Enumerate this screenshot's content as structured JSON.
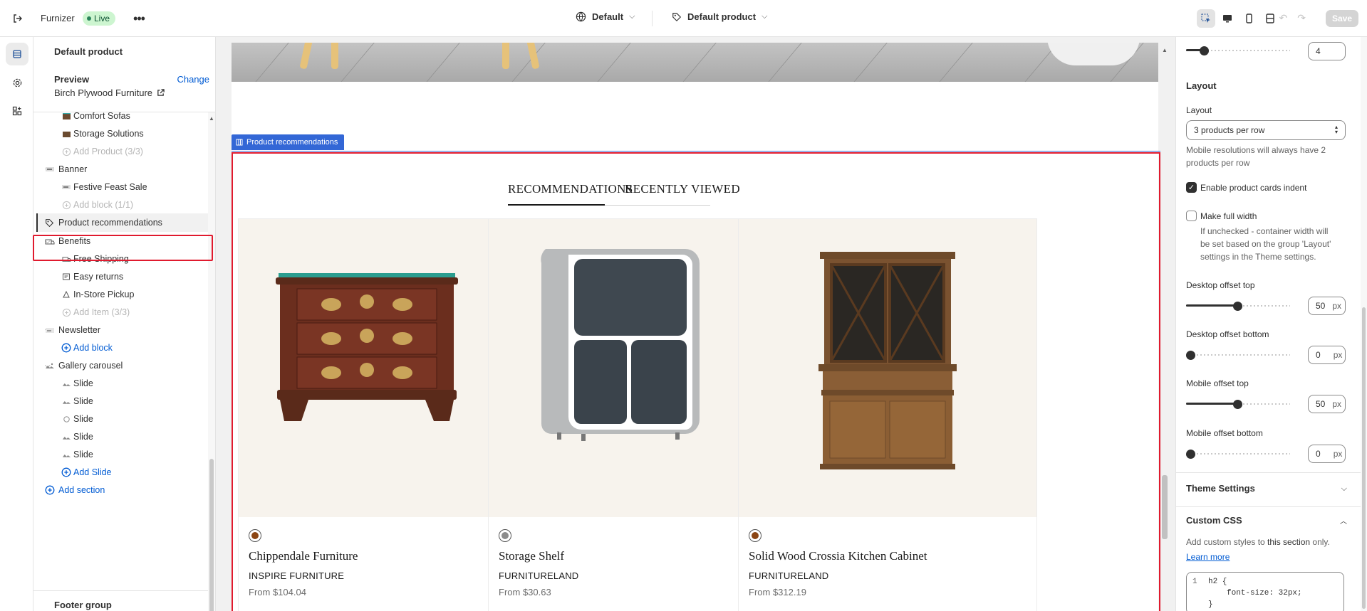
{
  "topbar": {
    "app_name": "Furnizer",
    "status_badge": "Live",
    "more_label": "•••",
    "theme_select": "Default",
    "template_select": "Default product",
    "save_label": "Save"
  },
  "sidebar": {
    "title": "Default product",
    "preview_label": "Preview",
    "change_label": "Change",
    "preview_store": "Birch Plywood Furniture",
    "items": [
      {
        "label": "Comfort Sofas",
        "level": 2,
        "icon": "product-icon"
      },
      {
        "label": "Storage Solutions",
        "level": 2,
        "icon": "product-icon"
      },
      {
        "label": "Add Product (3/3)",
        "level": 2,
        "icon": "plus-circle-icon",
        "state": "disabled"
      },
      {
        "label": "Banner",
        "level": 1,
        "icon": "banner-icon",
        "expanded": true
      },
      {
        "label": "Festive Feast Sale",
        "level": 2,
        "icon": "banner-icon"
      },
      {
        "label": "Add block (1/1)",
        "level": 2,
        "icon": "plus-circle-icon",
        "state": "disabled"
      },
      {
        "label": "Product recommendations",
        "level": 1,
        "icon": "tag-icon",
        "state": "selected"
      },
      {
        "label": "Benefits",
        "level": 1,
        "icon": "benefits-icon",
        "expanded": true
      },
      {
        "label": "Free Shipping",
        "level": 2,
        "icon": "truck-icon"
      },
      {
        "label": "Easy returns",
        "level": 2,
        "icon": "returns-icon"
      },
      {
        "label": "In-Store Pickup",
        "level": 2,
        "icon": "pickup-icon"
      },
      {
        "label": "Add Item (3/3)",
        "level": 2,
        "icon": "plus-circle-icon",
        "state": "disabled"
      },
      {
        "label": "Newsletter",
        "level": 1,
        "icon": "newsletter-icon",
        "expanded": true
      },
      {
        "label": "Add block",
        "level": 2,
        "icon": "plus-circle-icon",
        "state": "link"
      },
      {
        "label": "Gallery carousel",
        "level": 1,
        "icon": "gallery-icon",
        "expanded": true
      },
      {
        "label": "Slide",
        "level": 2,
        "icon": "slide-icon"
      },
      {
        "label": "Slide",
        "level": 2,
        "icon": "slide-icon"
      },
      {
        "label": "Slide",
        "level": 2,
        "icon": "slide-icon"
      },
      {
        "label": "Slide",
        "level": 2,
        "icon": "slide-icon"
      },
      {
        "label": "Slide",
        "level": 2,
        "icon": "slide-icon"
      },
      {
        "label": "Add Slide",
        "level": 2,
        "icon": "plus-circle-icon",
        "state": "link"
      },
      {
        "label": "Add section",
        "level": 1,
        "icon": "plus-circle-icon",
        "state": "link"
      }
    ],
    "footer_group": "Footer group"
  },
  "canvas": {
    "section_tag": "Product recommendations",
    "tabs": [
      "RECOMMENDATIONS",
      "RECENTLY VIEWED"
    ],
    "products": [
      {
        "name": "Chippendale Furniture",
        "vendor": "INSPIRE FURNITURE",
        "price": "From $104.04",
        "swatch": "#8b4513"
      },
      {
        "name": "Storage Shelf",
        "vendor": "FURNITURELAND",
        "price": "From $30.63",
        "swatch": "#8c8c8c"
      },
      {
        "name": "Solid Wood Crossia Kitchen Cabinet",
        "vendor": "FURNITURELAND",
        "price": "From $312.19",
        "swatch": "#8b4513"
      }
    ]
  },
  "settings": {
    "top_value": "4",
    "layout_heading": "Layout",
    "layout_label": "Layout",
    "layout_value": "3 products per row",
    "layout_help": [
      "Mobile resolutions will always have 2",
      "products per row"
    ],
    "indent_label": "Enable product cards indent",
    "indent_checked": true,
    "full_width_label": "Make full width",
    "full_width_checked": false,
    "full_width_help": [
      "If unchecked - container width will",
      "be set based on the group 'Layout'",
      "settings in the Theme settings."
    ],
    "desktop_top_label": "Desktop offset top",
    "desktop_top_value": "50",
    "desktop_bottom_label": "Desktop offset bottom",
    "desktop_bottom_value": "0",
    "mobile_top_label": "Mobile offset top",
    "mobile_top_value": "50",
    "mobile_bottom_label": "Mobile offset bottom",
    "mobile_bottom_value": "0",
    "unit": "px",
    "theme_settings": "Theme Settings",
    "custom_css": "Custom CSS",
    "custom_css_help_a": "Add custom styles to ",
    "custom_css_help_b": "this section",
    "custom_css_help_c": " only.",
    "learn_more": "Learn more",
    "code_lines": [
      "1",
      "h2 {",
      "font-size: 32px;",
      "}"
    ]
  },
  "colors": {
    "accent": "#005bd3",
    "selection": "#e01a2e",
    "section_tag": "#3367d6"
  }
}
